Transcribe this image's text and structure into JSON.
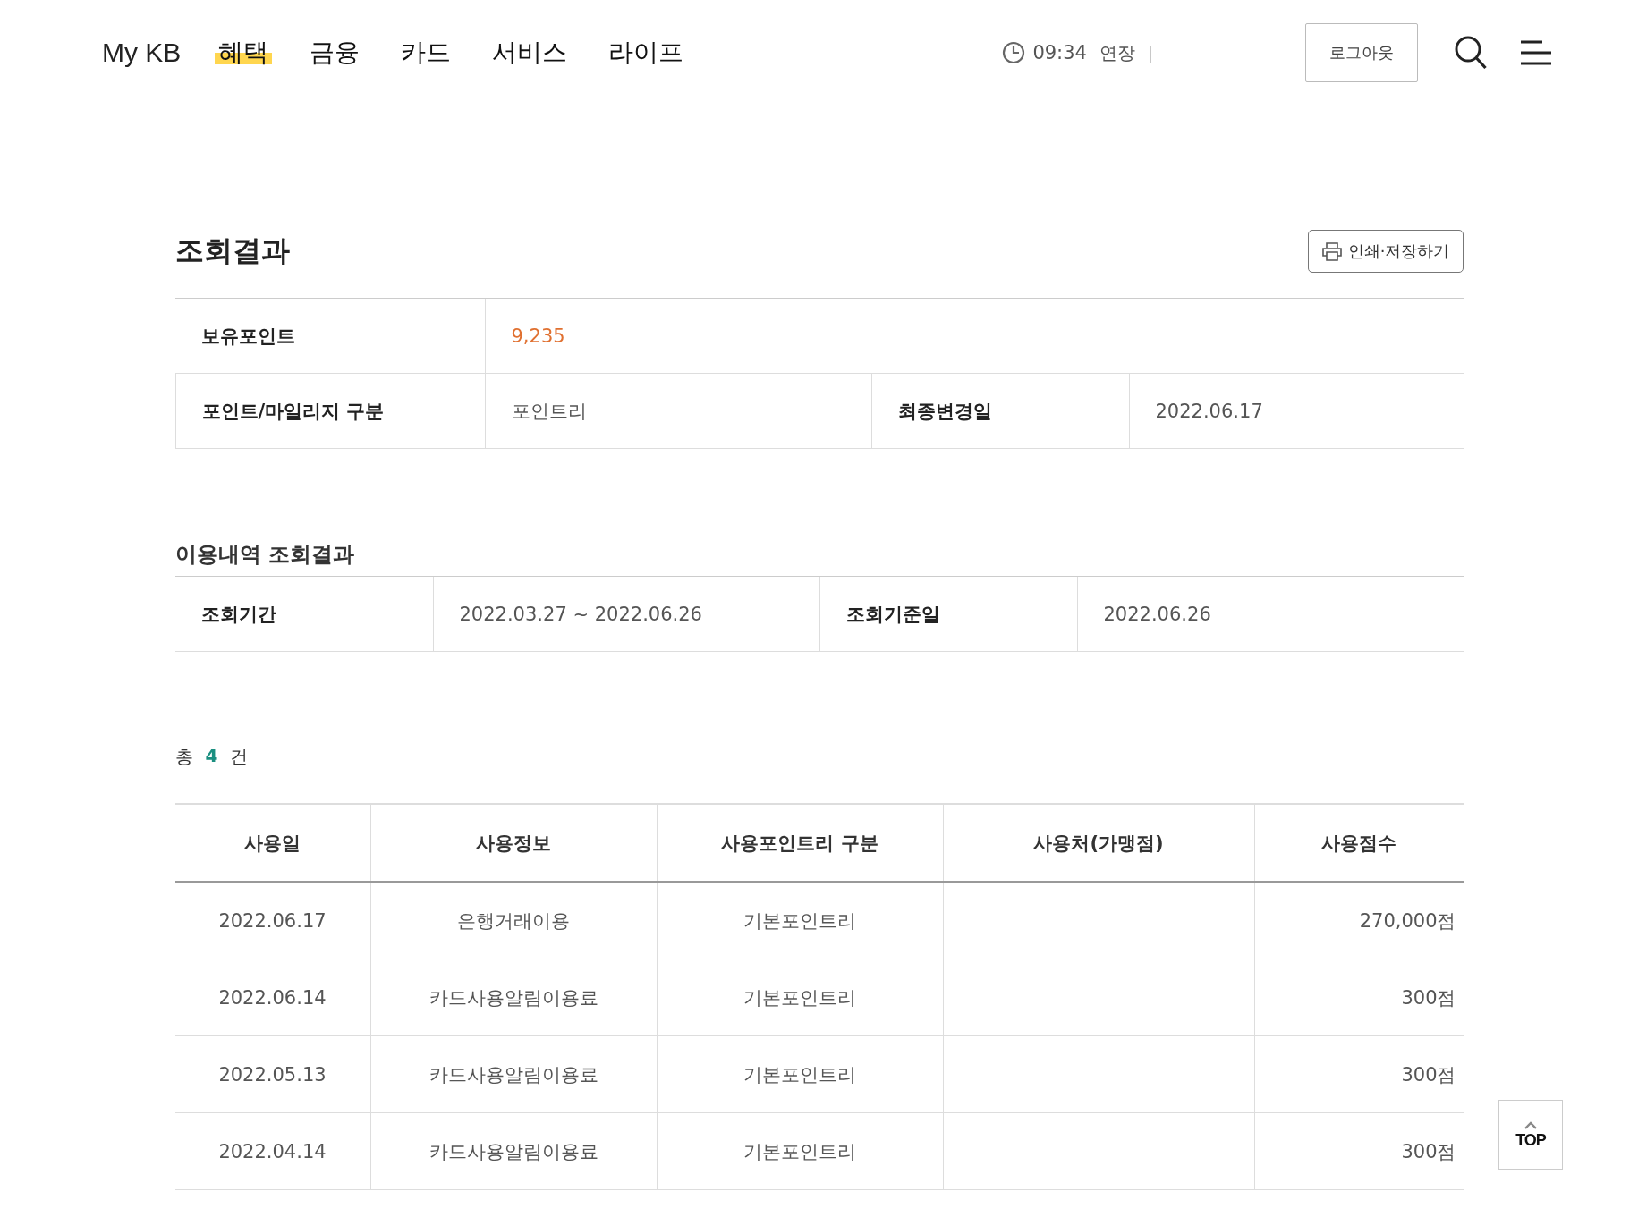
{
  "header": {
    "logo": "My KB",
    "nav": [
      {
        "label": "혜택",
        "selected": true
      },
      {
        "label": "금융",
        "selected": false
      },
      {
        "label": "카드",
        "selected": false
      },
      {
        "label": "서비스",
        "selected": false
      },
      {
        "label": "라이프",
        "selected": false
      }
    ],
    "session_time": "09:34",
    "extend_label": "연장",
    "separator": "|",
    "logout_button": "로그아웃"
  },
  "result": {
    "title": "조회결과",
    "print_button": "인쇄·저장하기",
    "summary": [
      {
        "label": "보유포인트",
        "value": "9,235",
        "highlight": true
      },
      {
        "label": "포인트/마일리지 구분",
        "value": "포인트리",
        "label_2": "최종변경일",
        "value_2": "2022.06.17",
        "highlight": false
      }
    ]
  },
  "usage": {
    "title": "이용내역 조회결과",
    "period_label": "조회기간",
    "period_value": "2022.03.27 ~ 2022.06.26",
    "base_date_label": "조회기준일",
    "base_date_value": "2022.06.26"
  },
  "count": {
    "prefix": "총",
    "number": "4",
    "suffix": "건"
  },
  "table": {
    "columns": [
      "사용일",
      "사용정보",
      "사용포인트리 구분",
      "사용처(가맹점)",
      "사용점수"
    ],
    "rows": [
      [
        "2022.06.17",
        "은행거래이용",
        "기본포인트리",
        "",
        "270,000점"
      ],
      [
        "2022.06.14",
        "카드사용알림이용료",
        "기본포인트리",
        "",
        "300점"
      ],
      [
        "2022.05.13",
        "카드사용알림이용료",
        "기본포인트리",
        "",
        "300점"
      ],
      [
        "2022.04.14",
        "카드사용알림이용료",
        "기본포인트리",
        "",
        "300점"
      ]
    ]
  },
  "top_button": "TOP"
}
